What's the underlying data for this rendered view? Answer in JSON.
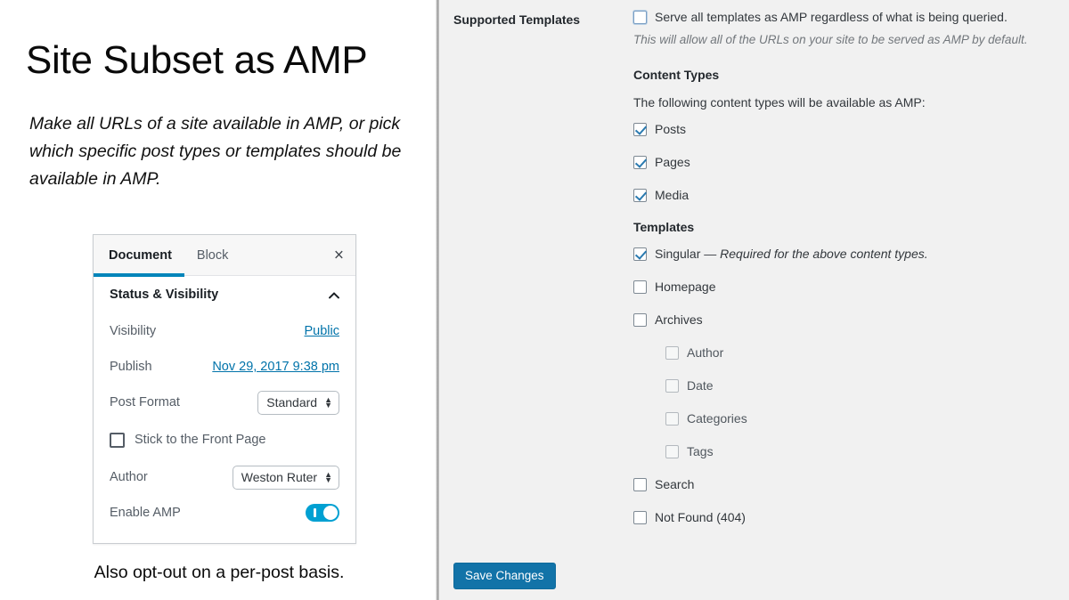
{
  "slide": {
    "title": "Site Subset as AMP",
    "subtitle": "Make all URLs of a site available in AMP, or pick which specific post types or templates should be available in AMP.",
    "caption": "Also opt-out on a per-post basis."
  },
  "doc_panel": {
    "tabs": [
      {
        "label": "Document",
        "active": true
      },
      {
        "label": "Block",
        "active": false
      }
    ],
    "close_label": "×",
    "section_title": "Status & Visibility",
    "rows": {
      "visibility_label": "Visibility",
      "visibility_value": "Public",
      "publish_label": "Publish",
      "publish_value": "Nov 29, 2017 9:38 pm",
      "post_format_label": "Post Format",
      "post_format_value": "Standard",
      "sticky_label": "Stick to the Front Page",
      "author_label": "Author",
      "author_value": "Weston Ruter",
      "enable_amp_label": "Enable AMP"
    }
  },
  "settings": {
    "section_label": "Supported Templates",
    "serve_all": {
      "label": "Serve all templates as AMP regardless of what is being queried.",
      "checked": false,
      "description": "This will allow all of the URLs on your site to be served as AMP by default."
    },
    "content_types": {
      "heading": "Content Types",
      "intro": "The following content types will be available as AMP:",
      "items": [
        {
          "label": "Posts",
          "checked": true
        },
        {
          "label": "Pages",
          "checked": true
        },
        {
          "label": "Media",
          "checked": true
        }
      ]
    },
    "templates": {
      "heading": "Templates",
      "items": [
        {
          "label": "Singular",
          "note": "— Required for the above content types.",
          "checked": true,
          "indent": false
        },
        {
          "label": "Homepage",
          "note": "",
          "checked": false,
          "indent": false
        },
        {
          "label": "Archives",
          "note": "",
          "checked": false,
          "indent": false
        },
        {
          "label": "Author",
          "note": "",
          "checked": false,
          "indent": true
        },
        {
          "label": "Date",
          "note": "",
          "checked": false,
          "indent": true
        },
        {
          "label": "Categories",
          "note": "",
          "checked": false,
          "indent": true
        },
        {
          "label": "Tags",
          "note": "",
          "checked": false,
          "indent": true
        },
        {
          "label": "Search",
          "note": "",
          "checked": false,
          "indent": false
        },
        {
          "label": "Not Found (404)",
          "note": "",
          "checked": false,
          "indent": false
        }
      ]
    },
    "save_label": "Save Changes",
    "colors": {
      "accent": "#0085ba",
      "save_button": "#1273a8",
      "toggle_on": "#00a0d2",
      "link": "#0073aa",
      "panel_bg": "#f1f1f1"
    }
  }
}
